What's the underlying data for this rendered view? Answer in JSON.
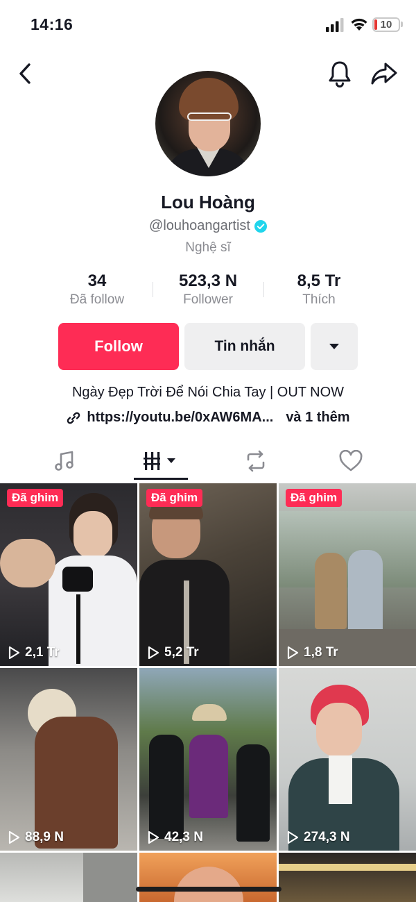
{
  "status_bar": {
    "time": "14:16",
    "battery": "10",
    "battery_level": 0.1
  },
  "profile": {
    "display_name": "Lou Hoàng",
    "handle": "@louhoangartist",
    "category": "Nghệ sĩ",
    "verified": true
  },
  "stats": {
    "following_value": "34",
    "following_label": "Đã follow",
    "followers_value": "523,3 N",
    "followers_label": "Follower",
    "likes_value": "8,5 Tr",
    "likes_label": "Thích"
  },
  "actions": {
    "follow_label": "Follow",
    "message_label": "Tin nhắn"
  },
  "bio": {
    "text": "Ngày Đẹp Trời Để Nói Chia Tay | OUT NOW",
    "link": "https://youtu.be/0xAW6MA...",
    "link_more": "và 1 thêm"
  },
  "tabs": [
    "music-icon",
    "videos-grid-icon",
    "repost-icon",
    "liked-heart-icon"
  ],
  "videos": [
    {
      "pinned_label": "Đã ghim",
      "views": "2,1 Tr"
    },
    {
      "pinned_label": "Đã ghim",
      "views": "5,2 Tr"
    },
    {
      "pinned_label": "Đã ghim",
      "views": "1,8 Tr"
    },
    {
      "views": "88,9 N"
    },
    {
      "views": "42,3 N"
    },
    {
      "views": "274,3 N"
    }
  ],
  "colors": {
    "accent": "#fe2c55",
    "text": "#161823",
    "secondary": "#8a8b91",
    "verified": "#20d5ec"
  }
}
